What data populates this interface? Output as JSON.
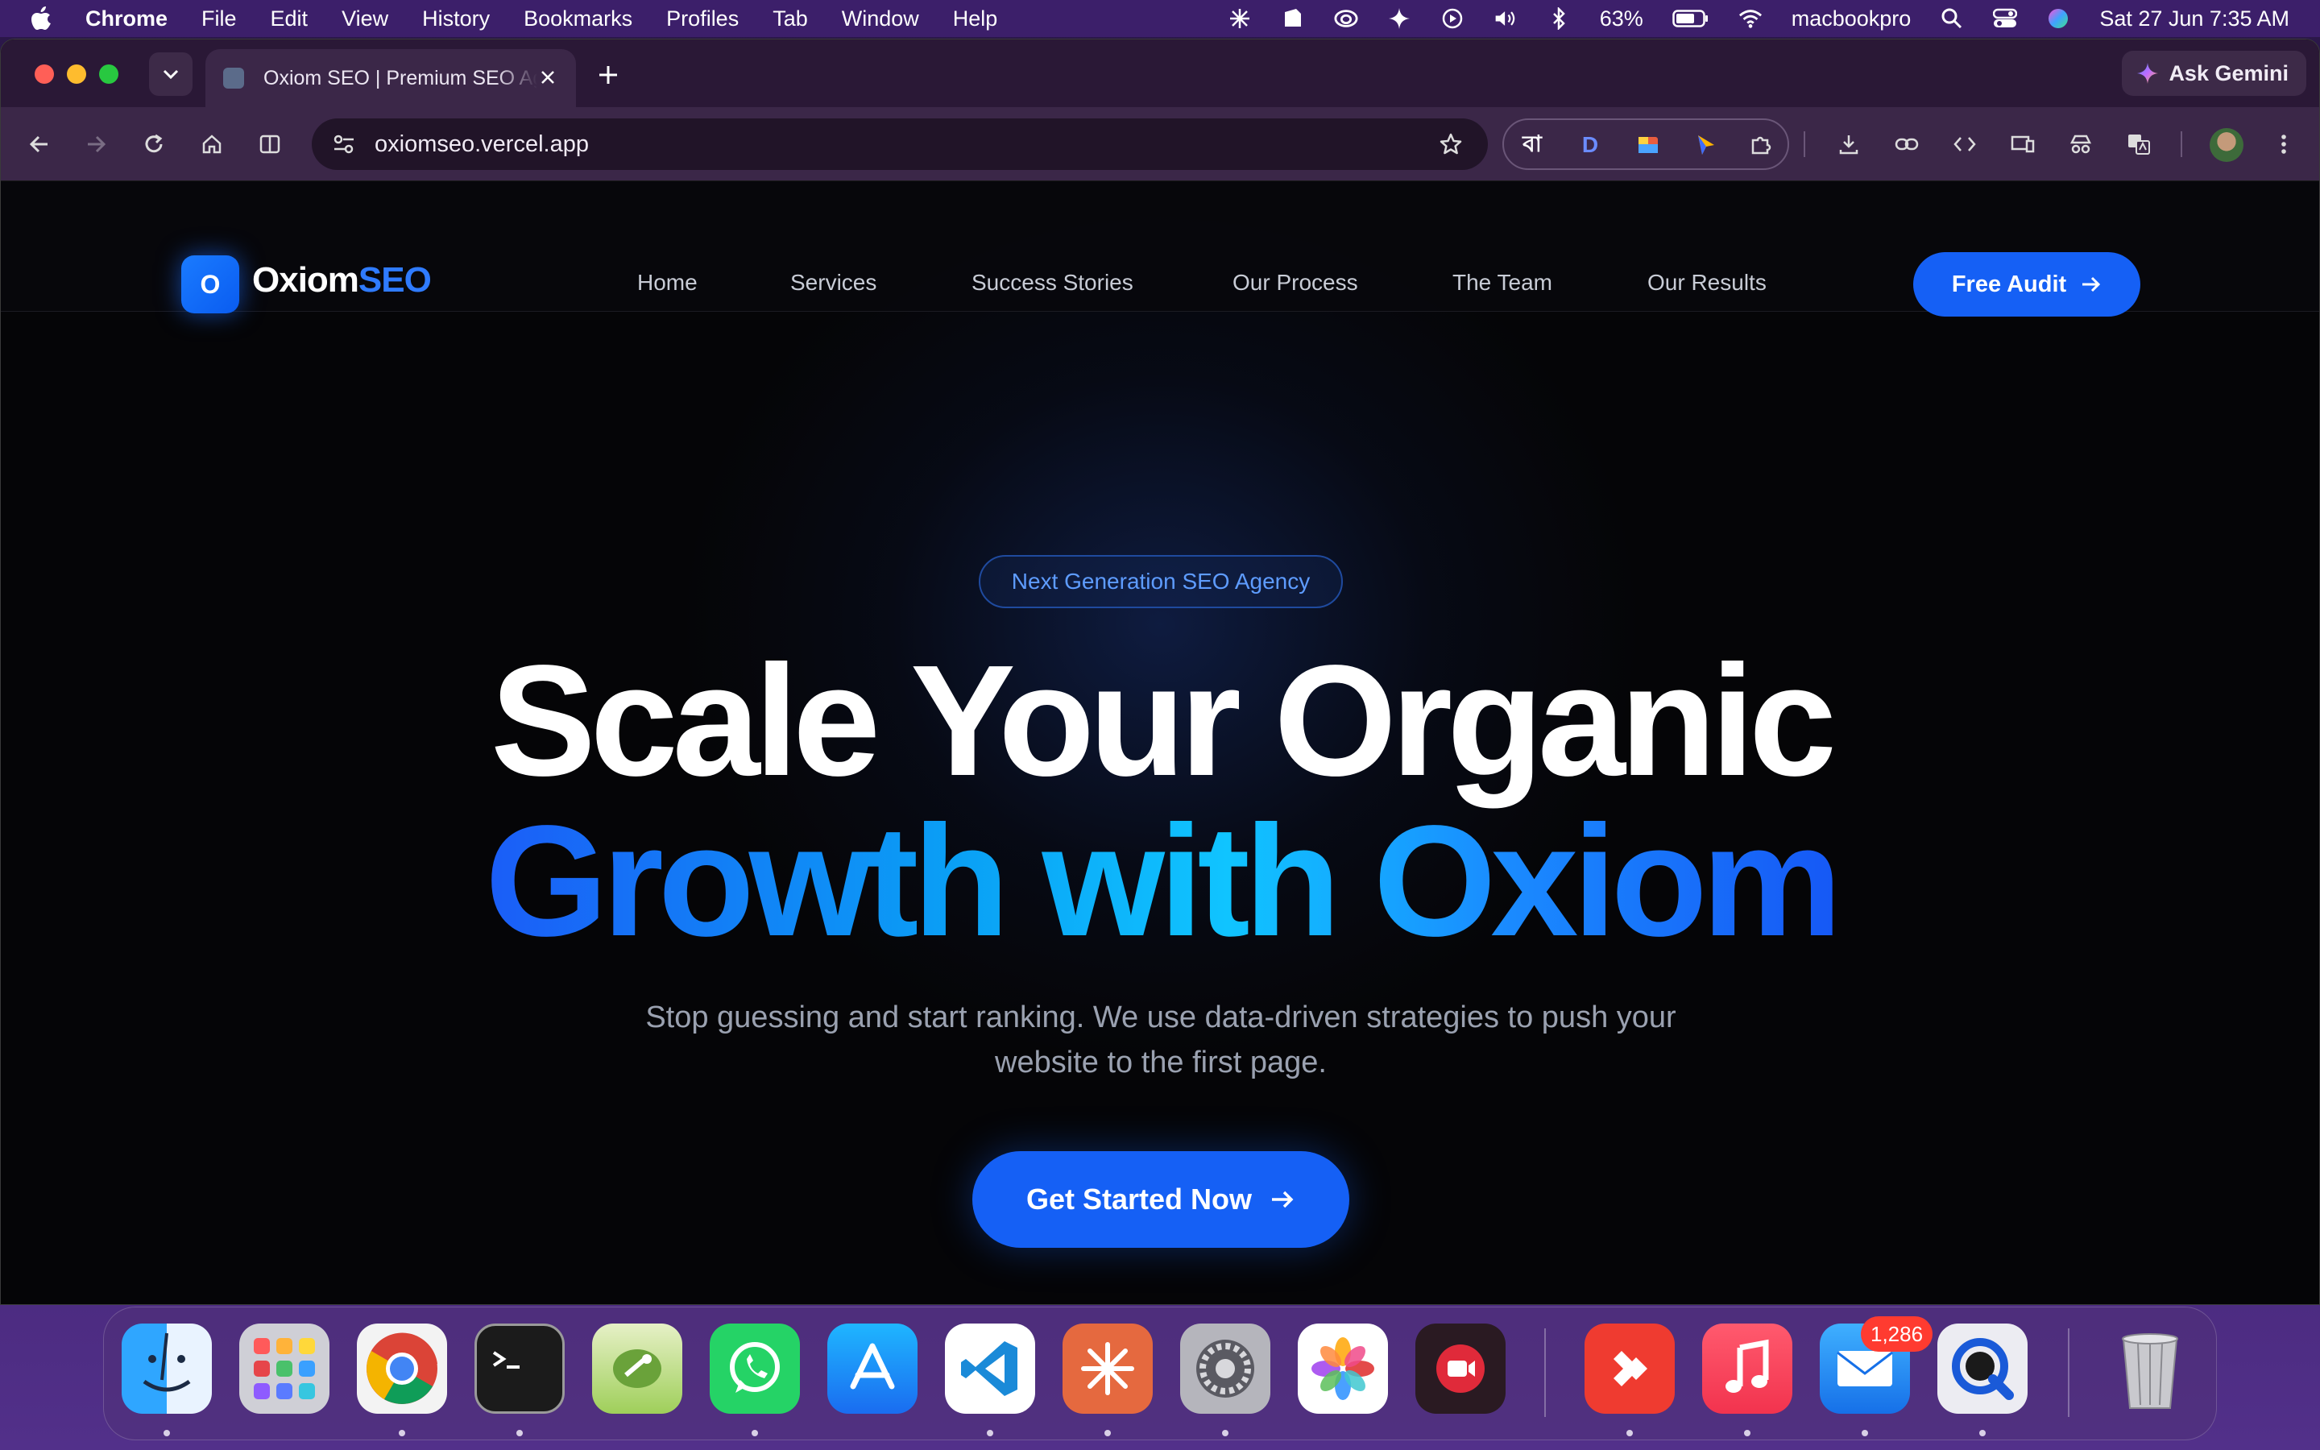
{
  "menubar": {
    "app_name": "Chrome",
    "menus": [
      "File",
      "Edit",
      "View",
      "History",
      "Bookmarks",
      "Profiles",
      "Tab",
      "Window",
      "Help"
    ],
    "battery": "63%",
    "hostname": "macbookpro",
    "datetime": "Sat 27 Jun  7:35 AM"
  },
  "browser": {
    "tab_title": "Oxiom SEO | Premium SEO Ag",
    "ask_gemini": "Ask Gemini",
    "url": "oxiomseo.vercel.app",
    "ext_bangla": "বা",
    "ext_d": "D"
  },
  "site": {
    "logo_mark": "O",
    "logo_text_1": "Oxiom",
    "logo_text_2": "SEO",
    "nav": [
      "Home",
      "Services",
      "Success Stories",
      "Our Process",
      "The Team",
      "Our Results"
    ],
    "cta_audit": "Free Audit",
    "badge": "Next Generation SEO Agency",
    "hero_line1": "Scale Your Organic",
    "hero_line2": "Growth with Oxiom",
    "subtitle": "Stop guessing and start ranking. We use data-driven strategies to push your website to the first page.",
    "cta_start": "Get Started Now"
  },
  "dock": {
    "mail_badge": "1,286",
    "apps": [
      "Finder",
      "Launchpad",
      "Google Chrome",
      "Terminal",
      "Rocket Typist",
      "WhatsApp",
      "App Store",
      "Visual Studio Code",
      "Claude",
      "System Settings",
      "Photos",
      "Screen Recorder",
      "AnyDesk",
      "Music",
      "Mail",
      "QuickTime Player",
      "Trash"
    ]
  },
  "colors": {
    "accent": "#1560f5",
    "brand_blue": "#2f7bff",
    "gradient_cyan": "#10c4ff",
    "page_bg": "#050507",
    "tab_bg": "#3b2748"
  }
}
